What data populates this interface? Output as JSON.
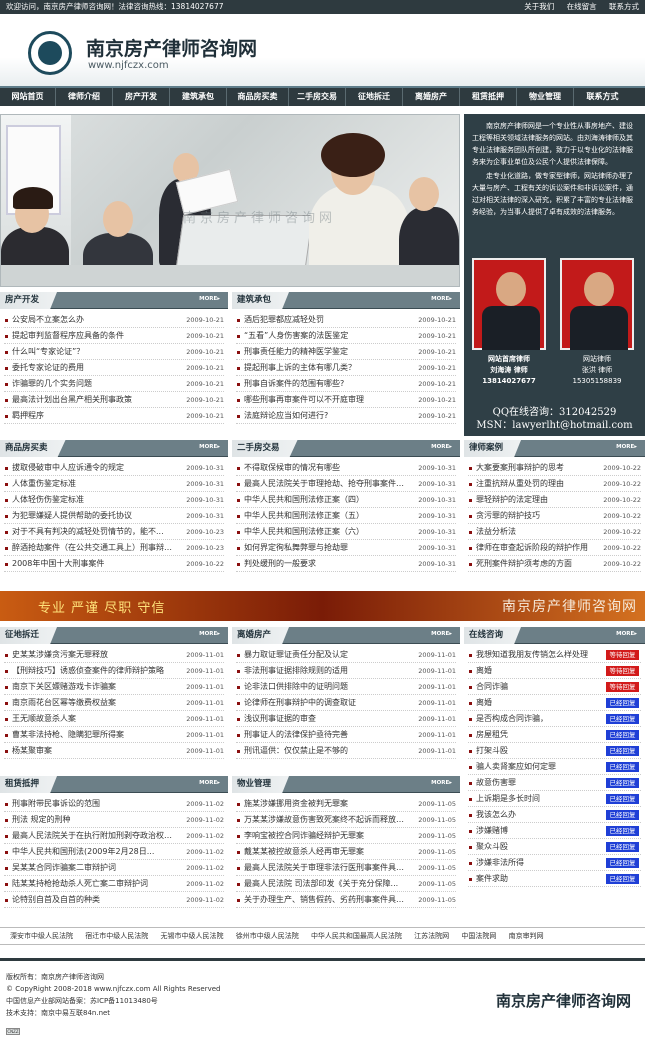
{
  "topbar": {
    "welcome": "欢迎访问，南京房产律师咨询网！法律咨询热线：13814027677",
    "about": "关于我们",
    "message": "在线留言",
    "contact": "联系方式"
  },
  "header": {
    "title": "南京房产律师咨询网",
    "url": "www.njfczx.com"
  },
  "nav": [
    "网站首页",
    "律师介绍",
    "房产开发",
    "建筑承包",
    "商品房买卖",
    "二手房交易",
    "征地拆迁",
    "离婚房产",
    "租赁抵押",
    "物业管理",
    "联系方式"
  ],
  "banner": {
    "watermark": "南京房产律师咨询网"
  },
  "intro": {
    "p1": "南京房产律师网是一个专业性从事房地产、建设工程等相关领域法律服务的网站。由刘海涛律师及其专业法律服务团队所创建，致力于以专业化的法律服务来为企事业单位及公民个人提供法律保障。",
    "p2": "走专业化道路，做专家型律师，网站律师办理了大量与房产、工程有关的诉讼案件和非诉讼案件，通过对相关法律的深入研究，积累了丰富的专业法律服务经验，为当事人提供了卓有成效的法律服务。",
    "lawyer1": {
      "line1": "网站首席律师",
      "line2": "刘海涛  律师",
      "phone": "13814027677"
    },
    "lawyer2": {
      "line1": "网站律师",
      "line2": "张洪  律师",
      "phone": "15305158839"
    },
    "qq": "QQ在线咨询：312042529",
    "msn": "MSN：lawyerlht@hotmail.com"
  },
  "more": "MORE▸",
  "boxes": {
    "fangchan": {
      "title": "房产开发",
      "items": [
        [
          "公安局不立案怎么办",
          "2009-10-21"
        ],
        [
          "提起审判监督程序应具备的条件",
          "2009-10-21"
        ],
        [
          "什么叫“专家论证”？",
          "2009-10-21"
        ],
        [
          "委托专家论证的费用",
          "2009-10-21"
        ],
        [
          "诈骗罪的几个实务问题",
          "2009-10-21"
        ],
        [
          "最高法计划出台黑产相关刑事政策",
          "2009-10-21"
        ],
        [
          "羁押程序",
          "2009-10-21"
        ]
      ]
    },
    "jianzhu": {
      "title": "建筑承包",
      "items": [
        [
          "酒后犯罪都应减轻处罚",
          "2009-10-21"
        ],
        [
          "“五看”人身伤害案的法医鉴定",
          "2009-10-21"
        ],
        [
          "刑事责任能力的精神医学鉴定",
          "2009-10-21"
        ],
        [
          "提起刑事上诉的主体有哪几类？",
          "2009-10-21"
        ],
        [
          "刑事自诉案件的范围有哪些?",
          "2009-10-21"
        ],
        [
          "哪些刑事再审案件可以不开庭审理",
          "2009-10-21"
        ],
        [
          "法庭辩论应当如何进行?",
          "2009-10-21"
        ]
      ]
    },
    "shangpin": {
      "title": "商品房买卖",
      "items": [
        [
          "拔取侵破审中人应诉通令的规定",
          "2009-10-31"
        ],
        [
          "人体重伤鉴定标准",
          "2009-10-31"
        ],
        [
          "人体轻伤伤鉴定标准",
          "2009-10-31"
        ],
        [
          "为犯罪嫌疑人提供帮助的委托协议",
          "2009-10-31"
        ],
        [
          "对于不具有判决的减轻处罚情节的，能不...",
          "2009-10-23"
        ],
        [
          "醉酒抢劫案件（在公共交通工具上）刑事辩护...",
          "2009-10-23"
        ],
        [
          "2008年中国十大刑事案件",
          "2009-10-22"
        ]
      ]
    },
    "ershou": {
      "title": "二手房交易",
      "items": [
        [
          "不得取保候审的情况有哪些",
          "2009-10-31"
        ],
        [
          "最高人民法院关于审理抢劫、抢夺刑事案件适...",
          "2009-10-31"
        ],
        [
          "中华人民共和国刑法修正案（四）",
          "2009-10-31"
        ],
        [
          "中华人民共和国刑法修正案（五）",
          "2009-10-31"
        ],
        [
          "中华人民共和国刑法修正案（六）",
          "2009-10-31"
        ],
        [
          "如何界定徇私舞弊罪与抢劫罪",
          "2009-10-31"
        ],
        [
          "判处缓刑的一般要求",
          "2009-10-31"
        ]
      ]
    },
    "anli": {
      "title": "律师案例",
      "items": [
        [
          "大案要案刑事辩护的思考",
          "2009-10-22"
        ],
        [
          "注重抗辩从重处罚的理由",
          "2009-10-22"
        ],
        [
          "罪轻辩护的法定理由",
          "2009-10-22"
        ],
        [
          "贪污罪的辩护技巧",
          "2009-10-22"
        ],
        [
          "法益分析法",
          "2009-10-22"
        ],
        [
          "律师在审查起诉阶段的辩护作用",
          "2009-10-22"
        ],
        [
          "死刑案件辩护须考虑的方面",
          "2009-10-22"
        ]
      ]
    },
    "zhengdi": {
      "title": "征地拆迁",
      "items": [
        [
          "史某某涉嫌贪污案无罪释放",
          "2009-11-01"
        ],
        [
          "【刑辩技巧】诱惑侦查案件的律师辩护策略",
          "2009-11-01"
        ],
        [
          "南京下关区嫖赌游戏卡诈骗案",
          "2009-11-01"
        ],
        [
          "南京雨花台区幂等缴费权益案",
          "2009-11-01"
        ],
        [
          "王无顺故意杀人案",
          "2009-11-01"
        ],
        [
          "曹某非法持枪、隐瞒犯罪所得案",
          "2009-11-01"
        ],
        [
          "杨某聚审案",
          "2009-11-01"
        ]
      ]
    },
    "lihun": {
      "title": "离婚房产",
      "items": [
        [
          "暴力取证罪证责任分配及认定",
          "2009-11-01"
        ],
        [
          "非法刑事证据排除规则的适用",
          "2009-11-01"
        ],
        [
          "论非法口供排除中的证明问题",
          "2009-11-01"
        ],
        [
          "论律师在刑事辩护中的调查取证",
          "2009-11-01"
        ],
        [
          "浅议刑事证据的审查",
          "2009-11-01"
        ],
        [
          "刑事证人的法律保护亟待完善",
          "2009-11-01"
        ],
        [
          "刑讯逼供：仅仅禁止是不够的",
          "2009-11-01"
        ]
      ]
    },
    "zulin": {
      "title": "租赁抵押",
      "items": [
        [
          "刑事附带民事诉讼的范围",
          "2009-11-02"
        ],
        [
          "刑法 规定的刑种",
          "2009-11-02"
        ],
        [
          "最高人民法院关于在执行附加刑剥夺政治权利...",
          "2009-11-02"
        ],
        [
          "中华人民共和国刑法(2009年2月28日...",
          "2009-11-02"
        ],
        [
          "吴某某合同诈骗案二审辩护词",
          "2009-11-02"
        ],
        [
          "陆某某持枪抢劫杀人死亡案二审辩护词",
          "2009-11-02"
        ],
        [
          "论特别自首及自首的种类",
          "2009-11-02"
        ]
      ]
    },
    "wuye": {
      "title": "物业管理",
      "items": [
        [
          "施某涉嫌挪用资金被判无罪案",
          "2009-11-05"
        ],
        [
          "万某某涉嫌故意伤害致死案终不起诉而释放的...",
          "2009-11-05"
        ],
        [
          "李响宝被控合同诈骗经辩护无罪案",
          "2009-11-05"
        ],
        [
          "戴某某被控故意杀人经再审无罪案",
          "2009-11-05"
        ],
        [
          "最高人民法院关于审理非法行医刑事案件具体...",
          "2009-11-05"
        ],
        [
          "最高人民法院 司法部印发《关于充分保障...",
          "2009-11-05"
        ],
        [
          "关于办理生产、销售假药、劣药刑事案件具体...",
          "2009-11-05"
        ]
      ]
    },
    "zixun": {
      "title": "在线咨询",
      "items": [
        [
          "我想知道我朋友传销怎么样处理",
          "等待回复"
        ],
        [
          "离婚",
          "等待回复"
        ],
        [
          "合同诈骗",
          "等待回复"
        ],
        [
          "离婚",
          "已经回复"
        ],
        [
          "是否构成合同诈骗，",
          "已经回复"
        ],
        [
          "房屋租凭",
          "已经回复"
        ],
        [
          "打架斗殴",
          "已经回复"
        ],
        [
          "骗人卖肾案应如何定罪",
          "已经回复"
        ],
        [
          "故意伤害罪",
          "已经回复"
        ],
        [
          "上诉期是多长时间",
          "已经回复"
        ],
        [
          "我该怎么办",
          "已经回复"
        ],
        [
          "涉嫌赌博",
          "已经回复"
        ],
        [
          "聚众斗殴",
          "已经回复"
        ],
        [
          "涉嫌非法所得",
          "已经回复"
        ],
        [
          "案件求助",
          "已经回复"
        ]
      ]
    }
  },
  "slogan": {
    "left": "专业  严谨  尽职  守信",
    "right": "南京房产律师咨询网"
  },
  "links": [
    "溧安市中级人民法院",
    "宿迁市中级人民法院",
    "无锡市中级人民法院",
    "徐州市中级人民法院",
    "中华人民共和国最高人民法院",
    "江苏法院网",
    "中国法院网",
    "南京审判网"
  ],
  "footer": {
    "l1": "版权所有：南京房产律师咨询网",
    "l2": "© CopyRight 2008-2018 www.njfczx.com All Rights Reserved",
    "l3": "中国信息产业部网站备案：苏ICP备11013480号",
    "l4": "技术支持：南京中易互联84n.net",
    "name": "南京房产律师咨询网",
    "cnzz": "CNZZ"
  },
  "colors": {
    "waiting": "#d21a1a",
    "replied": "#1f3fd6",
    "dark": "#2e3a3f"
  }
}
